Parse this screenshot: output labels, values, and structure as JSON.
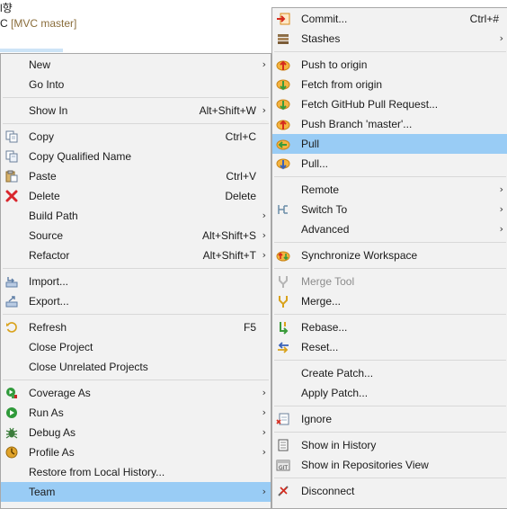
{
  "background": {
    "line1": "l향",
    "line2_prefix": "C",
    "line2_decoration": "[MVC master]"
  },
  "left_menu": {
    "items": [
      {
        "label": "New",
        "accel": "",
        "submenu": true,
        "icon": "none"
      },
      {
        "label": "Go Into",
        "accel": "",
        "submenu": false,
        "icon": "none"
      },
      {
        "label": "Show In",
        "accel": "Alt+Shift+W",
        "submenu": true,
        "icon": "none"
      },
      {
        "label": "Copy",
        "accel": "Ctrl+C",
        "submenu": false,
        "icon": "copy-icon"
      },
      {
        "label": "Copy Qualified Name",
        "accel": "",
        "submenu": false,
        "icon": "copy-qualified-icon"
      },
      {
        "label": "Paste",
        "accel": "Ctrl+V",
        "submenu": false,
        "icon": "paste-icon"
      },
      {
        "label": "Delete",
        "accel": "Delete",
        "submenu": false,
        "icon": "delete-icon"
      },
      {
        "label": "Build Path",
        "accel": "",
        "submenu": true,
        "icon": "none"
      },
      {
        "label": "Source",
        "accel": "Alt+Shift+S",
        "submenu": true,
        "icon": "none"
      },
      {
        "label": "Refactor",
        "accel": "Alt+Shift+T",
        "submenu": true,
        "icon": "none"
      },
      {
        "label": "Import...",
        "accel": "",
        "submenu": false,
        "icon": "import-icon"
      },
      {
        "label": "Export...",
        "accel": "",
        "submenu": false,
        "icon": "export-icon"
      },
      {
        "label": "Refresh",
        "accel": "F5",
        "submenu": false,
        "icon": "refresh-icon"
      },
      {
        "label": "Close Project",
        "accel": "",
        "submenu": false,
        "icon": "none"
      },
      {
        "label": "Close Unrelated Projects",
        "accel": "",
        "submenu": false,
        "icon": "none"
      },
      {
        "label": "Coverage As",
        "accel": "",
        "submenu": true,
        "icon": "coverage-icon"
      },
      {
        "label": "Run As",
        "accel": "",
        "submenu": true,
        "icon": "run-icon"
      },
      {
        "label": "Debug As",
        "accel": "",
        "submenu": true,
        "icon": "debug-icon"
      },
      {
        "label": "Profile As",
        "accel": "",
        "submenu": true,
        "icon": "profile-icon"
      },
      {
        "label": "Restore from Local History...",
        "accel": "",
        "submenu": false,
        "icon": "none"
      },
      {
        "label": "Team",
        "accel": "",
        "submenu": true,
        "icon": "none"
      }
    ]
  },
  "right_menu": {
    "items": [
      {
        "label": "Commit...",
        "accel": "Ctrl+#",
        "submenu": false,
        "icon": "commit-icon"
      },
      {
        "label": "Stashes",
        "accel": "",
        "submenu": true,
        "icon": "stash-icon"
      },
      {
        "label": "Push to origin",
        "accel": "",
        "submenu": false,
        "icon": "push-icon"
      },
      {
        "label": "Fetch from origin",
        "accel": "",
        "submenu": false,
        "icon": "fetch-icon"
      },
      {
        "label": "Fetch GitHub Pull Request...",
        "accel": "",
        "submenu": false,
        "icon": "fetch-pr-icon"
      },
      {
        "label": "Push Branch 'master'...",
        "accel": "",
        "submenu": false,
        "icon": "push-branch-icon"
      },
      {
        "label": "Pull",
        "accel": "",
        "submenu": false,
        "icon": "pull-icon"
      },
      {
        "label": "Pull...",
        "accel": "",
        "submenu": false,
        "icon": "pull-dialog-icon"
      },
      {
        "label": "Remote",
        "accel": "",
        "submenu": true,
        "icon": "none"
      },
      {
        "label": "Switch To",
        "accel": "",
        "submenu": true,
        "icon": "switch-branch-icon"
      },
      {
        "label": "Advanced",
        "accel": "",
        "submenu": true,
        "icon": "none"
      },
      {
        "label": "Synchronize Workspace",
        "accel": "",
        "submenu": false,
        "icon": "synchronize-icon"
      },
      {
        "label": "Merge Tool",
        "accel": "",
        "submenu": false,
        "icon": "merge-tool-icon"
      },
      {
        "label": "Merge...",
        "accel": "",
        "submenu": false,
        "icon": "merge-icon"
      },
      {
        "label": "Rebase...",
        "accel": "",
        "submenu": false,
        "icon": "rebase-icon"
      },
      {
        "label": "Reset...",
        "accel": "",
        "submenu": false,
        "icon": "reset-icon"
      },
      {
        "label": "Create Patch...",
        "accel": "",
        "submenu": false,
        "icon": "none"
      },
      {
        "label": "Apply Patch...",
        "accel": "",
        "submenu": false,
        "icon": "none"
      },
      {
        "label": "Ignore",
        "accel": "",
        "submenu": false,
        "icon": "ignore-icon"
      },
      {
        "label": "Show in History",
        "accel": "",
        "submenu": false,
        "icon": "history-icon"
      },
      {
        "label": "Show in Repositories View",
        "accel": "",
        "submenu": false,
        "icon": "repositories-icon"
      },
      {
        "label": "Disconnect",
        "accel": "",
        "submenu": false,
        "icon": "disconnect-icon"
      }
    ]
  },
  "submenu_arrow": "›"
}
